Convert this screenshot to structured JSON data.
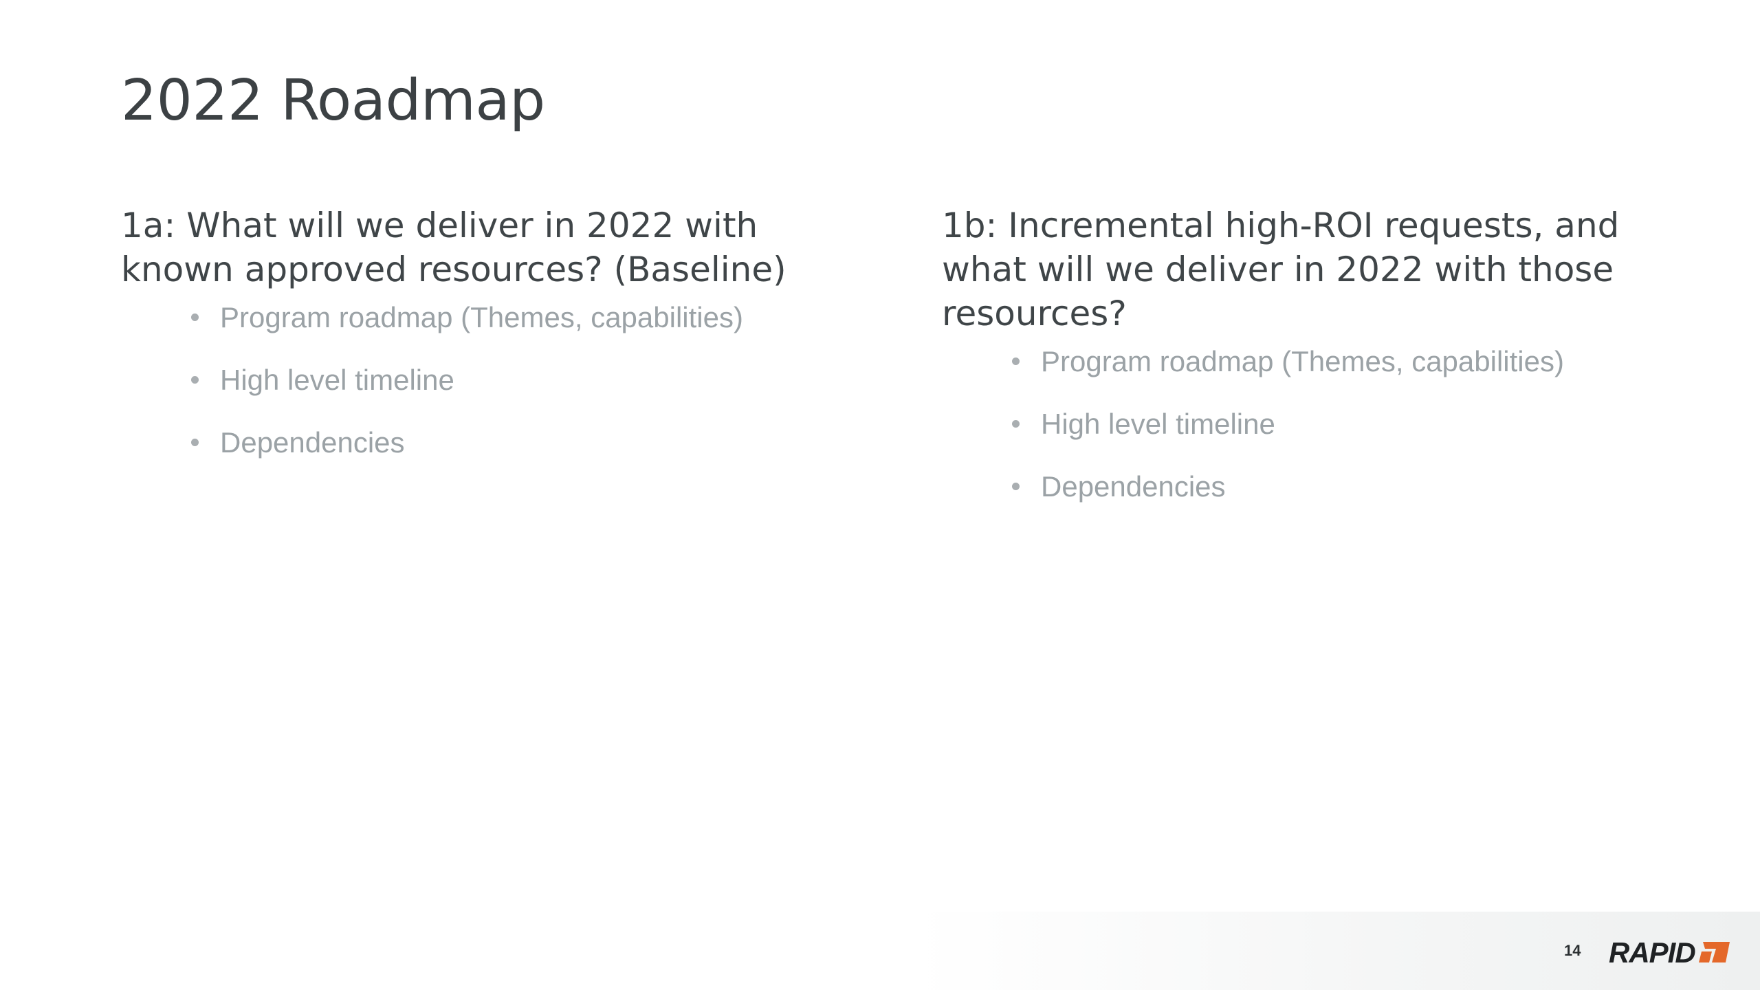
{
  "slide": {
    "title": "2022 Roadmap",
    "page_number": "14",
    "logo_text": "RAPID7"
  },
  "left_column": {
    "heading_line1": "1a: What will we deliver in 2022 with",
    "heading_line2": "known approved resources? (Baseline)",
    "bullets": [
      "Program roadmap (Themes, capabilities)",
      "High level timeline",
      "Dependencies"
    ]
  },
  "right_column": {
    "heading_line1": "1b: Incremental high-ROI requests, and",
    "heading_line2": "what will we deliver in 2022 with those",
    "heading_line3": "resources?",
    "bullets": [
      "Program roadmap (Themes, capabilities)",
      "High level timeline",
      "Dependencies"
    ]
  },
  "colors": {
    "title": "#3c4144",
    "body": "#3f4548",
    "bullet_text": "#9ba2a6",
    "logo_dark": "#1f2224",
    "logo_accent": "#e4682a"
  }
}
